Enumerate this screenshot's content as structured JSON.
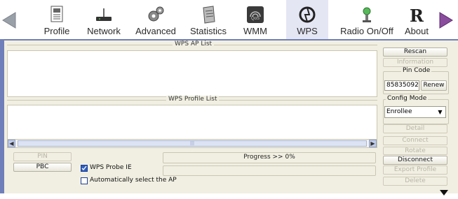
{
  "toolbar": {
    "items": [
      {
        "label": "Profile"
      },
      {
        "label": "Network"
      },
      {
        "label": "Advanced"
      },
      {
        "label": "Statistics"
      },
      {
        "label": "WMM"
      },
      {
        "label": "WPS"
      },
      {
        "label": "Radio On/Off"
      },
      {
        "label": "About"
      }
    ],
    "active": "WPS",
    "wmm_badge": "QoS",
    "about_logo": "R"
  },
  "wps_ap_list": {
    "title": "WPS AP List"
  },
  "wps_profile_list": {
    "title": "WPS Profile List"
  },
  "buttons": {
    "rescan": "Rescan",
    "information": "Information",
    "renew": "Renew",
    "detail": "Detail",
    "connect": "Connect",
    "rotate": "Rotate",
    "disconnect": "Disconnect",
    "export_profile": "Export Profile",
    "delete": "Delete",
    "pin": "PIN",
    "pbc": "PBC"
  },
  "pin_code": {
    "label": "Pin Code",
    "value": "85835092"
  },
  "config_mode": {
    "label": "Config Mode",
    "value": "Enrollee"
  },
  "progress": {
    "text": "Progress >> 0%",
    "value": 0
  },
  "checkboxes": {
    "wps_probe_ie": {
      "label": "WPS Probe IE",
      "checked": true
    },
    "auto_select_ap": {
      "label": "Automatically select the AP",
      "checked": false
    }
  },
  "colors": {
    "accent": "#6f7fb9",
    "panel_bg": "#f1efe2",
    "active_tab_bg": "#e4e6f4"
  }
}
